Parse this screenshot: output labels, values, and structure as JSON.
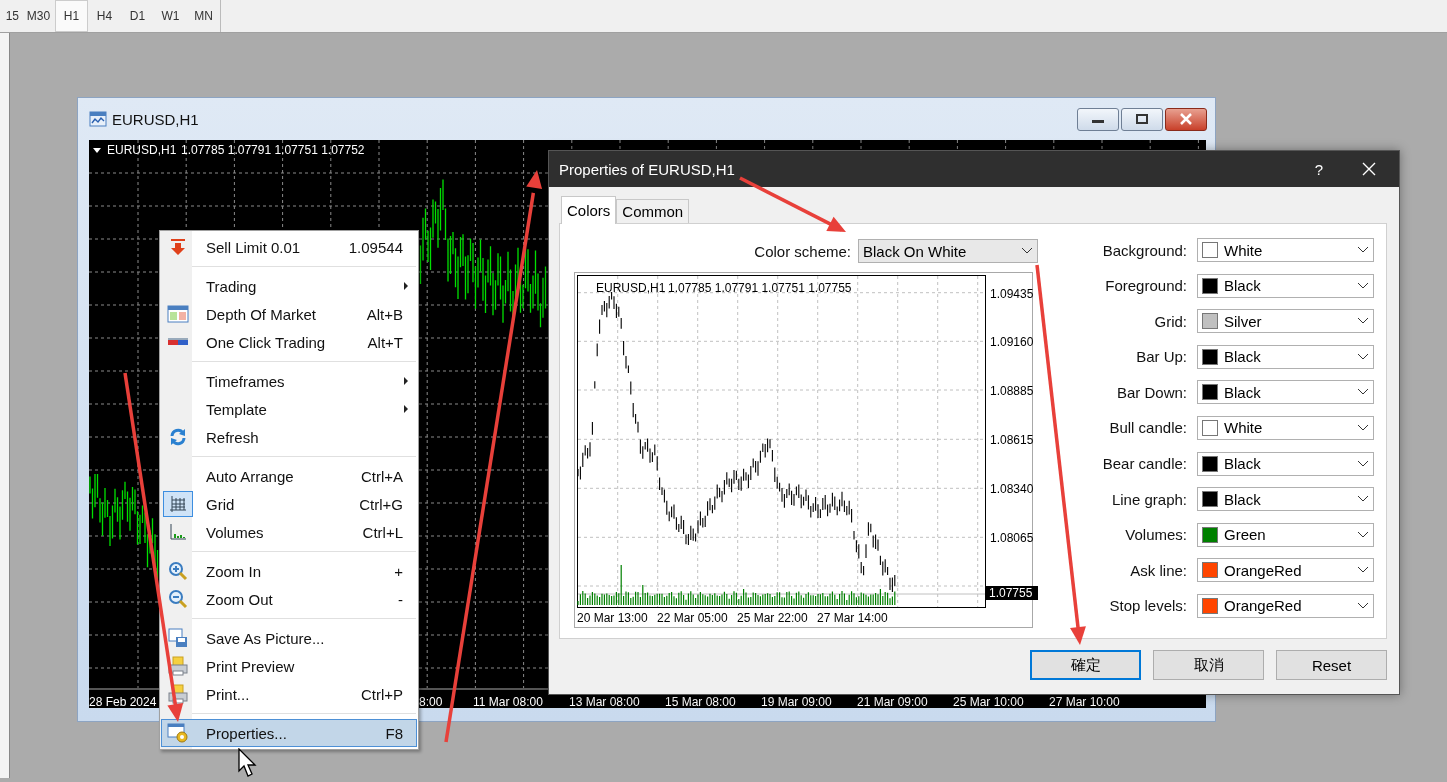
{
  "toolbar": {
    "timeframes": [
      {
        "label": "15",
        "selected": false
      },
      {
        "label": "M30",
        "selected": false
      },
      {
        "label": "H1",
        "selected": true
      },
      {
        "label": "H4",
        "selected": false
      },
      {
        "label": "D1",
        "selected": false
      },
      {
        "label": "W1",
        "selected": false
      },
      {
        "label": "MN",
        "selected": false
      }
    ]
  },
  "chart_window": {
    "title": "EURUSD,H1",
    "chart": {
      "symbol": "EURUSD,H1",
      "prices": "1.07785 1.07791 1.07751 1.07752",
      "x_labels": [
        "28 Feb 2024",
        "8:00",
        "11 Mar 08:00",
        "13 Mar 08:00",
        "15 Mar 08:00",
        "19 Mar 09:00",
        "21 Mar 09:00",
        "25 Mar 10:00",
        "27 Mar 10:00"
      ]
    }
  },
  "context_menu": {
    "items": [
      {
        "kind": "item",
        "label": "Sell Limit 0.01",
        "shortcut": "1.09544",
        "submenu": false,
        "checked": false,
        "selected": false
      },
      {
        "kind": "separator"
      },
      {
        "kind": "item",
        "label": "Trading",
        "submenu": true,
        "checked": false,
        "selected": false
      },
      {
        "kind": "item",
        "label": "Depth Of Market",
        "shortcut": "Alt+B",
        "submenu": false,
        "checked": false,
        "selected": false
      },
      {
        "kind": "item",
        "label": "One Click Trading",
        "shortcut": "Alt+T",
        "submenu": false,
        "checked": false,
        "selected": false
      },
      {
        "kind": "separator"
      },
      {
        "kind": "item",
        "label": "Timeframes",
        "submenu": true,
        "checked": false,
        "selected": false
      },
      {
        "kind": "item",
        "label": "Template",
        "submenu": true,
        "checked": false,
        "selected": false
      },
      {
        "kind": "item",
        "label": "Refresh",
        "submenu": false,
        "checked": false,
        "selected": false
      },
      {
        "kind": "separator"
      },
      {
        "kind": "item",
        "label": "Auto Arrange",
        "shortcut": "Ctrl+A",
        "submenu": false,
        "checked": false,
        "selected": false
      },
      {
        "kind": "item",
        "label": "Grid",
        "shortcut": "Ctrl+G",
        "submenu": false,
        "checked": true,
        "selected": false
      },
      {
        "kind": "item",
        "label": "Volumes",
        "shortcut": "Ctrl+L",
        "submenu": false,
        "checked": false,
        "selected": false
      },
      {
        "kind": "separator"
      },
      {
        "kind": "item",
        "label": "Zoom In",
        "shortcut": "+",
        "submenu": false,
        "checked": false,
        "selected": false
      },
      {
        "kind": "item",
        "label": "Zoom Out",
        "shortcut": "-",
        "submenu": false,
        "checked": false,
        "selected": false
      },
      {
        "kind": "separator"
      },
      {
        "kind": "item",
        "label": "Save As Picture...",
        "submenu": false,
        "checked": false,
        "selected": false
      },
      {
        "kind": "item",
        "label": "Print Preview",
        "submenu": false,
        "checked": false,
        "selected": false
      },
      {
        "kind": "item",
        "label": "Print...",
        "shortcut": "Ctrl+P",
        "submenu": false,
        "checked": false,
        "selected": false
      },
      {
        "kind": "separator"
      },
      {
        "kind": "item",
        "label": "Properties...",
        "shortcut": "F8",
        "submenu": false,
        "checked": false,
        "selected": true
      }
    ]
  },
  "dialog": {
    "title": "Properties of EURUSD,H1",
    "help": "?",
    "tabs": [
      {
        "label": "Colors",
        "selected": true
      },
      {
        "label": "Common",
        "selected": false
      }
    ],
    "color_scheme": {
      "label": "Color scheme:",
      "value": "Black On White"
    },
    "preview": {
      "symbol": "EURUSD,H1",
      "prices": "1.07785 1.07791 1.07751 1.07755",
      "y_labels": [
        "1.09435",
        "1.09160",
        "1.08885",
        "1.08615",
        "1.08340",
        "1.08065"
      ],
      "current_price": "1.07755",
      "x_labels": [
        "20 Mar 13:00",
        "22 Mar 05:00",
        "25 Mar 22:00",
        "27 Mar 14:00"
      ]
    },
    "properties": [
      {
        "label": "Background:",
        "value": "White",
        "color": "#ffffff"
      },
      {
        "label": "Foreground:",
        "value": "Black",
        "color": "#000000"
      },
      {
        "label": "Grid:",
        "value": "Silver",
        "color": "#c0c0c0"
      },
      {
        "label": "Bar Up:",
        "value": "Black",
        "color": "#000000"
      },
      {
        "label": "Bar Down:",
        "value": "Black",
        "color": "#000000"
      },
      {
        "label": "Bull candle:",
        "value": "White",
        "color": "#ffffff"
      },
      {
        "label": "Bear candle:",
        "value": "Black",
        "color": "#000000"
      },
      {
        "label": "Line graph:",
        "value": "Black",
        "color": "#000000"
      },
      {
        "label": "Volumes:",
        "value": "Green",
        "color": "#008000"
      },
      {
        "label": "Ask line:",
        "value": "OrangeRed",
        "color": "#ff4500"
      },
      {
        "label": "Stop levels:",
        "value": "OrangeRed",
        "color": "#ff4500"
      }
    ],
    "buttons": [
      {
        "label": "確定",
        "default": true
      },
      {
        "label": "取消",
        "default": false
      },
      {
        "label": "Reset",
        "default": false
      }
    ]
  }
}
